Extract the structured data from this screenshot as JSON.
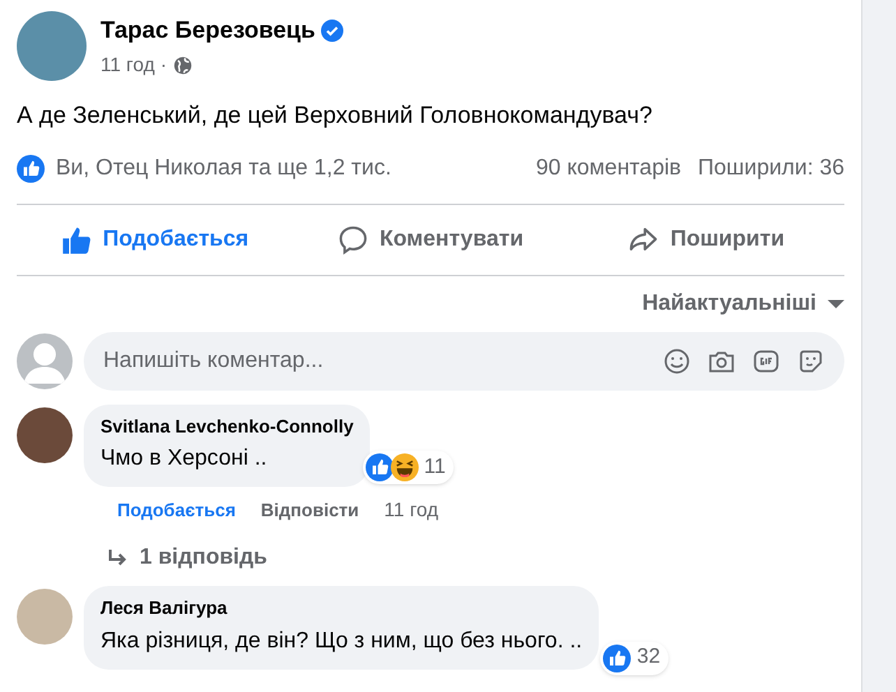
{
  "post": {
    "author": "Тарас Березовець",
    "verified": true,
    "time": "11 год",
    "separator": "·",
    "text": "А де Зеленський, де цей Верховний Головнокомандувач?",
    "reactions_summary": "Ви, Отец Николая та ще 1,2 тис.",
    "comments_count": "90 коментарів",
    "shares_count": "Поширили: 36"
  },
  "actions": [
    {
      "kind": "like",
      "label": "Подобається",
      "selected": true
    },
    {
      "kind": "comment",
      "label": "Коментувати",
      "selected": false
    },
    {
      "kind": "share",
      "label": "Поширити",
      "selected": false
    }
  ],
  "sort": {
    "label": "Найактуальніші"
  },
  "comment_box": {
    "placeholder": "Напишіть коментар..."
  },
  "comments": [
    {
      "author": "Svitlana Levchenko-Connolly",
      "text": "Чмо в Херсоні ..",
      "reactions": [
        {
          "kind": "like"
        },
        {
          "kind": "haha"
        }
      ],
      "reaction_count": "11",
      "like_label": "Подобається",
      "liked": true,
      "reply_label": "Відповісти",
      "time": "11 год",
      "replies": "1 відповідь"
    },
    {
      "author": "Леся Валігура",
      "text": "Яка різниця, де він? Що з ним, що без нього. ..",
      "reactions": [
        {
          "kind": "like"
        }
      ],
      "reaction_count": "32"
    }
  ]
}
